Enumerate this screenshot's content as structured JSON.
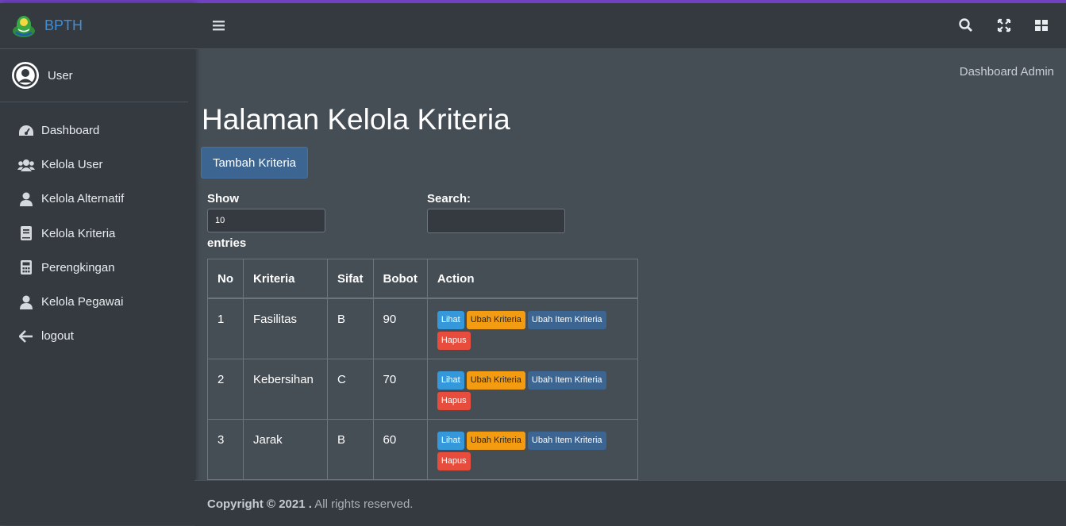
{
  "brand": {
    "name": "BPTH"
  },
  "user": {
    "name": "User"
  },
  "sidebar": {
    "items": [
      {
        "label": "Dashboard",
        "icon": "tachometer-icon"
      },
      {
        "label": "Kelola User",
        "icon": "users-icon"
      },
      {
        "label": "Kelola Alternatif",
        "icon": "user-icon"
      },
      {
        "label": "Kelola Kriteria",
        "icon": "book-icon"
      },
      {
        "label": "Perengkingan",
        "icon": "calculator-icon"
      },
      {
        "label": "Kelola Pegawai",
        "icon": "user-icon"
      },
      {
        "label": "logout",
        "icon": "arrow-left-icon"
      }
    ]
  },
  "header": {
    "icons": [
      "bars-icon",
      "search-icon",
      "expand-icon",
      "th-large-icon"
    ]
  },
  "breadcrumb": "Dashboard Admin",
  "page": {
    "title": "Halaman Kelola Kriteria",
    "add_button": "Tambah Kriteria",
    "show_label": "Show",
    "entries_value": "10",
    "entries_label": "entries",
    "search_label": "Search:",
    "search_value": ""
  },
  "table": {
    "headers": [
      "No",
      "Kriteria",
      "Sifat",
      "Bobot",
      "Action"
    ],
    "rows": [
      {
        "no": "1",
        "kriteria": "Fasilitas",
        "sifat": "B",
        "bobot": "90"
      },
      {
        "no": "2",
        "kriteria": "Kebersihan",
        "sifat": "C",
        "bobot": "70"
      },
      {
        "no": "3",
        "kriteria": "Jarak",
        "sifat": "B",
        "bobot": "60"
      }
    ],
    "actions": {
      "view": "Lihat",
      "edit": "Ubah Kriteria",
      "edit_items": "Ubah Item Kriteria",
      "delete": "Hapus"
    }
  },
  "footer": {
    "strong": "Copyright © 2021 .",
    "rest": " All rights reserved."
  },
  "colors": {
    "accent": "#6f42c1",
    "sidebar_bg": "#343a40",
    "content_bg": "#454d55",
    "primary": "#3c6592",
    "info": "#3498db",
    "warning": "#f39c12",
    "danger": "#e74c3c"
  }
}
